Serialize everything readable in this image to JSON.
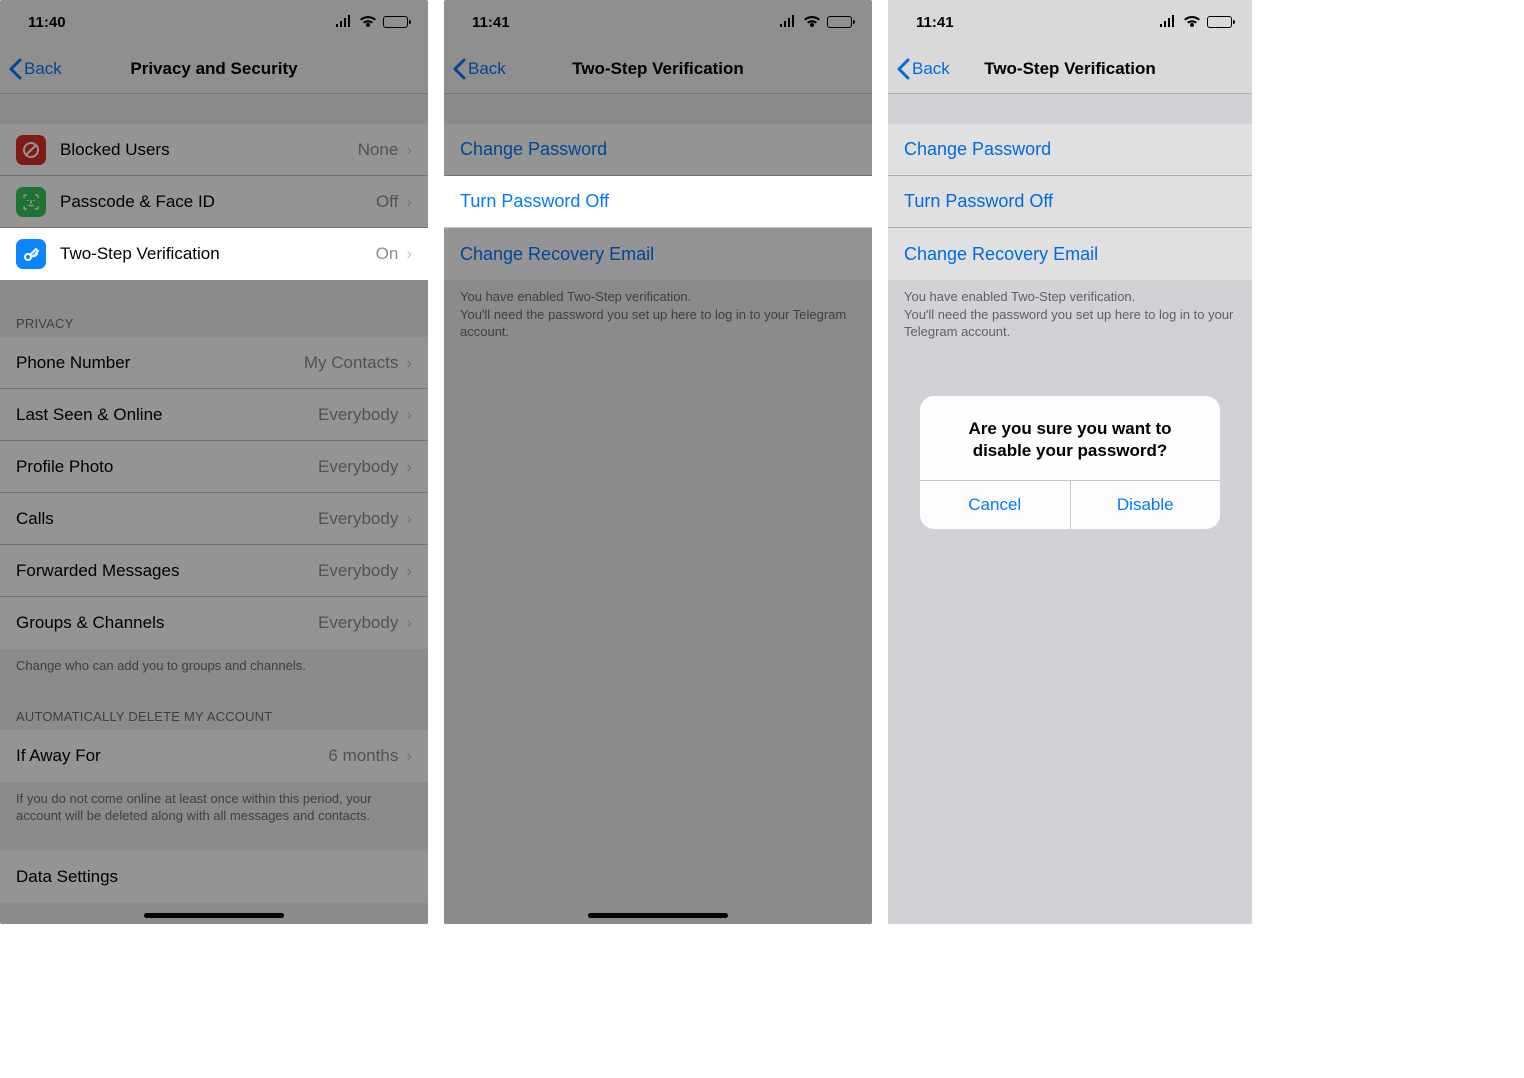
{
  "phone1": {
    "time": "11:40",
    "title": "Privacy and Security",
    "back": "Back",
    "security_rows": [
      {
        "label": "Blocked Users",
        "value": "None",
        "icon": "block",
        "icon_color": "#d93025"
      },
      {
        "label": "Passcode & Face ID",
        "value": "Off",
        "icon": "faceid",
        "icon_color": "#34c759"
      },
      {
        "label": "Two-Step Verification",
        "value": "On",
        "icon": "key",
        "icon_color": "#0a84ff"
      }
    ],
    "privacy_header": "PRIVACY",
    "privacy_rows": [
      {
        "label": "Phone Number",
        "value": "My Contacts"
      },
      {
        "label": "Last Seen & Online",
        "value": "Everybody"
      },
      {
        "label": "Profile Photo",
        "value": "Everybody"
      },
      {
        "label": "Calls",
        "value": "Everybody"
      },
      {
        "label": "Forwarded Messages",
        "value": "Everybody"
      },
      {
        "label": "Groups & Channels",
        "value": "Everybody"
      }
    ],
    "privacy_footer": "Change who can add you to groups and channels.",
    "auto_header": "AUTOMATICALLY DELETE MY ACCOUNT",
    "auto_row": {
      "label": "If Away For",
      "value": "6 months"
    },
    "auto_footer": "If you do not come online at least once within this period, your account will be deleted along with all messages and contacts.",
    "data_section_label": "Data Settings"
  },
  "phone2": {
    "time": "11:41",
    "title": "Two-Step Verification",
    "back": "Back",
    "rows": [
      "Change Password",
      "Turn Password Off",
      "Change Recovery Email"
    ],
    "footer": "You have enabled Two-Step verification.\nYou'll need the password you set up here to log in to your Telegram account."
  },
  "phone3": {
    "time": "11:41",
    "title": "Two-Step Verification",
    "back": "Back",
    "rows": [
      "Change Password",
      "Turn Password Off",
      "Change Recovery Email"
    ],
    "footer": "You have enabled Two-Step verification.\nYou'll need the password you set up here to log in to your Telegram account.",
    "alert": {
      "title": "Are you sure you want to disable your password?",
      "cancel": "Cancel",
      "confirm": "Disable"
    }
  }
}
